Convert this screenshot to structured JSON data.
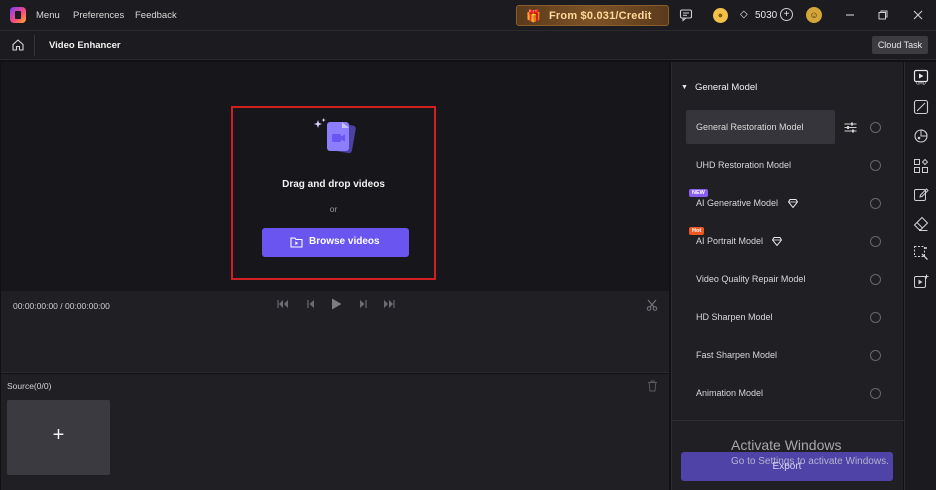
{
  "titlebar": {
    "menus": [
      "Menu",
      "Preferences",
      "Feedback"
    ],
    "promo_text": "From $0.031/Credit",
    "credits": "5030"
  },
  "subbar": {
    "page_title": "Video Enhancer",
    "cloud_task": "Cloud Task"
  },
  "dropzone": {
    "title": "Drag and drop videos",
    "or": "or",
    "browse_label": "Browse videos"
  },
  "player": {
    "timecode": "00:00:00:00 / 00:00:00:00"
  },
  "source": {
    "label": "Source(0/0)",
    "add_symbol": "+"
  },
  "models": {
    "section_title": "General Model",
    "items": [
      {
        "name": "General Restoration Model",
        "selected": true
      },
      {
        "name": "UHD Restoration Model"
      },
      {
        "name": "AI Generative Model",
        "badge": "NEW",
        "premium": true
      },
      {
        "name": "AI Portrait Model",
        "badge": "Hot",
        "premium": true
      },
      {
        "name": "Video Quality Repair Model"
      },
      {
        "name": "HD Sharpen Model"
      },
      {
        "name": "Fast Sharpen Model"
      },
      {
        "name": "Animation Model"
      }
    ],
    "export_label": "Export"
  },
  "watermark": {
    "line1": "Activate Windows",
    "line2": "Go to Settings to activate Windows."
  },
  "colors": {
    "accent": "#6a55f0",
    "highlight_border": "#d21f1f",
    "promo_text": "#ffd89b"
  }
}
